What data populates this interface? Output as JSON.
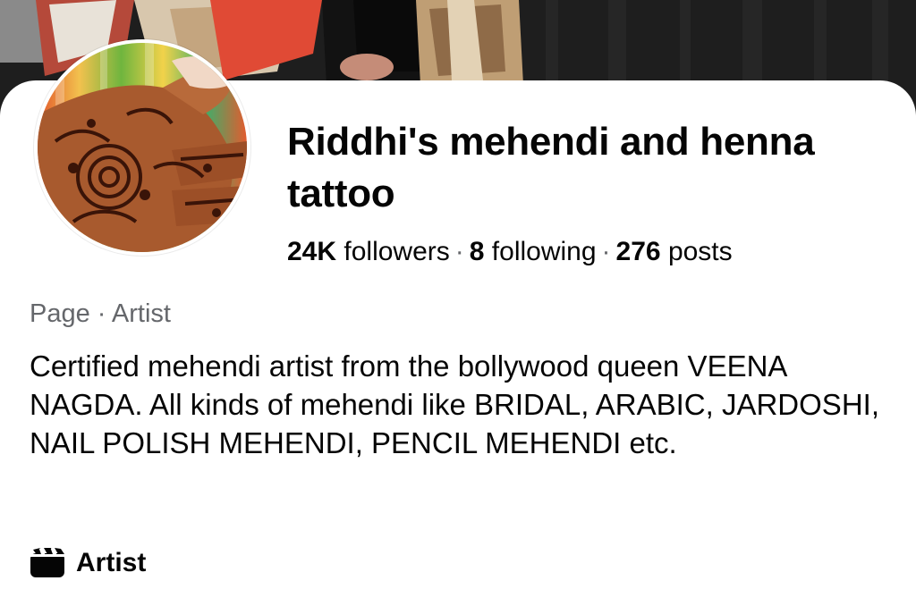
{
  "profile": {
    "name": "Riddhi's mehendi and henna tattoo",
    "stats": {
      "followers_count": "24K",
      "followers_label": "followers",
      "following_count": "8",
      "following_label": "following",
      "posts_count": "276",
      "posts_label": "posts",
      "separator": "·"
    },
    "meta": "Page · Artist",
    "bio": "Certified mehendi artist from the bollywood queen VEENA NAGDA. All kinds of mehendi like BRIDAL, ARABIC, JARDOSHI, NAIL POLISH MEHENDI, PENCIL MEHENDI etc.",
    "category": {
      "icon": "clapperboard-icon",
      "label": "Artist"
    }
  },
  "colors": {
    "text_primary": "#050505",
    "text_secondary": "#65676b",
    "background": "#ffffff"
  }
}
